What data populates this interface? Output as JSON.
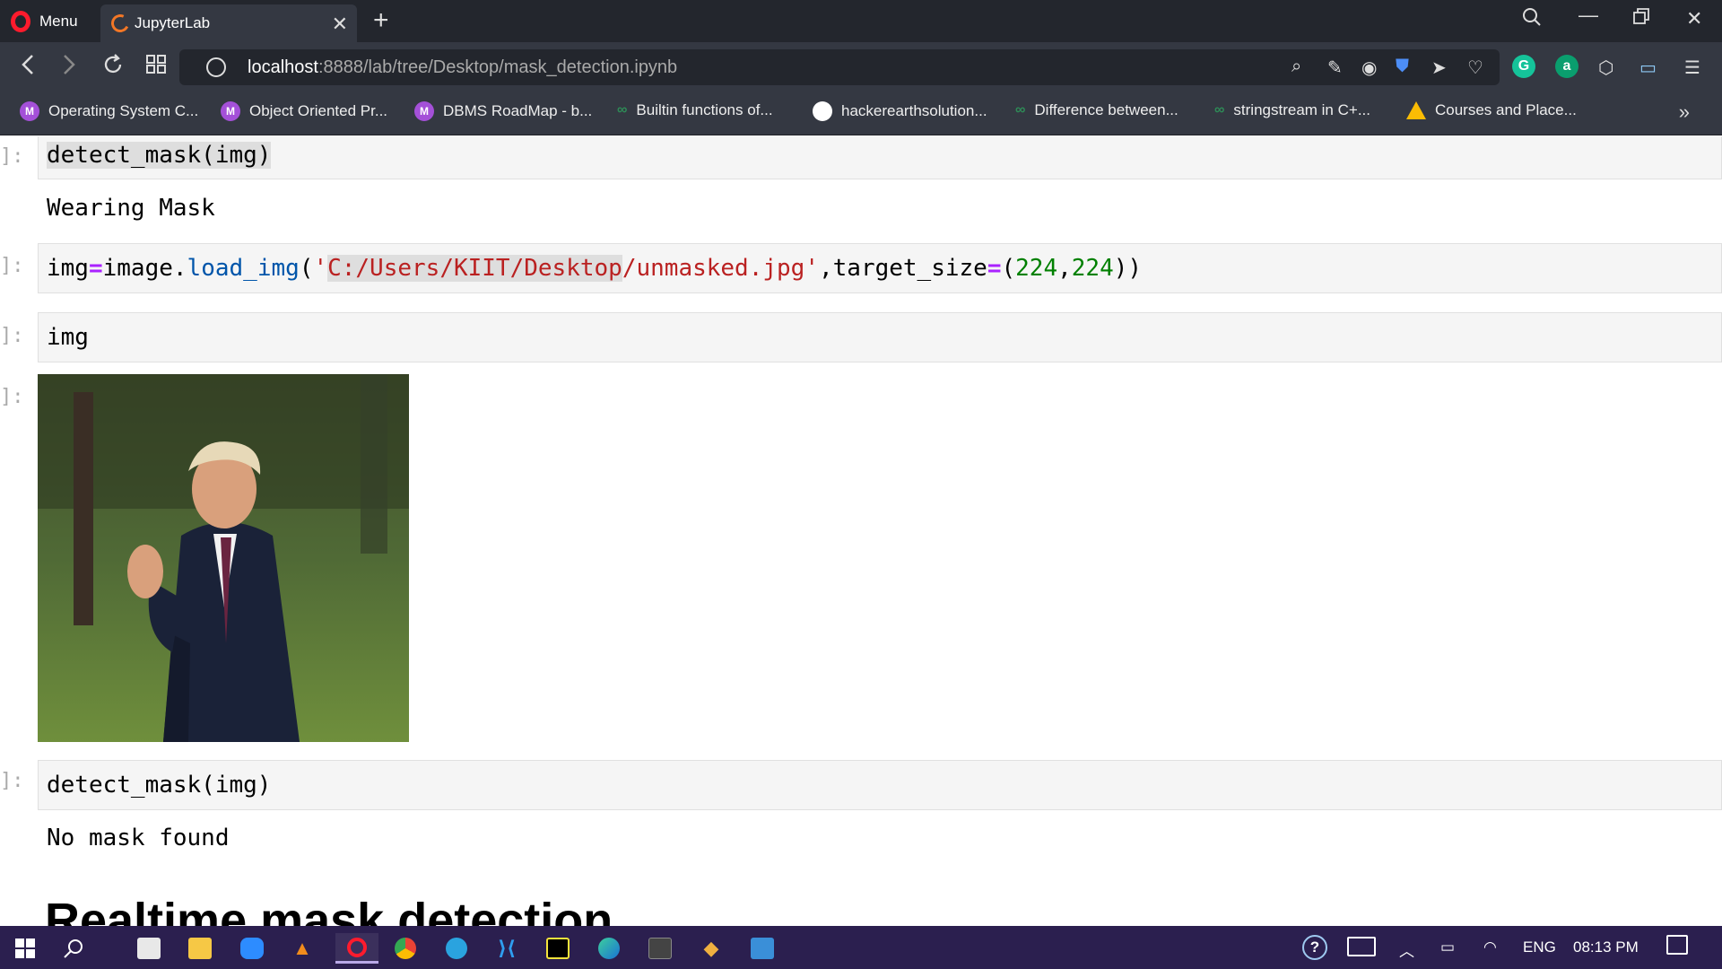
{
  "browser": {
    "menu_label": "Menu",
    "tab_title": "JupyterLab",
    "url_host": "localhost",
    "url_path": ":8888/lab/tree/Desktop/mask_detection.ipynb"
  },
  "bookmarks": [
    {
      "label": "Operating System C...",
      "icon": "M"
    },
    {
      "label": "Object Oriented Pr...",
      "icon": "M"
    },
    {
      "label": "DBMS RoadMap - b...",
      "icon": "M"
    },
    {
      "label": "Builtin functions of...",
      "icon": "gg"
    },
    {
      "label": "hackerearthsolution...",
      "icon": "github"
    },
    {
      "label": "Difference between...",
      "icon": "gg"
    },
    {
      "label": "stringstream in C+...",
      "icon": "gg"
    },
    {
      "label": "Courses and Place...",
      "icon": "drive"
    }
  ],
  "notebook": {
    "prompt": "]:",
    "cell1": {
      "code": "detect_mask(img)",
      "output": "Wearing Mask"
    },
    "cell2": {
      "var": "img",
      "op_assign": "=",
      "obj": "image.",
      "fn": "load_img",
      "paren_open": "(",
      "quote_open": "'",
      "path_highlight": "C:/Users/KIIT/Desktop",
      "path_rest": "/unmasked.jpg'",
      "comma": ",",
      "kwarg": "target_size",
      "op_kw": "=",
      "tuple_open": "(",
      "num1": "224",
      "num_sep": ",",
      "num2": "224",
      "close": "))"
    },
    "cell3": {
      "code": "img"
    },
    "cell4": {
      "code": "detect_mask(img)",
      "output": "No mask found"
    },
    "heading": "Realtime mask detection"
  },
  "taskbar": {
    "language": "ENG",
    "time": "08:13 PM"
  },
  "colors": {
    "titlebar": "#23262d",
    "toolbar": "#343842",
    "taskbar": "#2b1f4f",
    "opera_red": "#ff1b2d",
    "jupyter_orange": "#f37726"
  }
}
